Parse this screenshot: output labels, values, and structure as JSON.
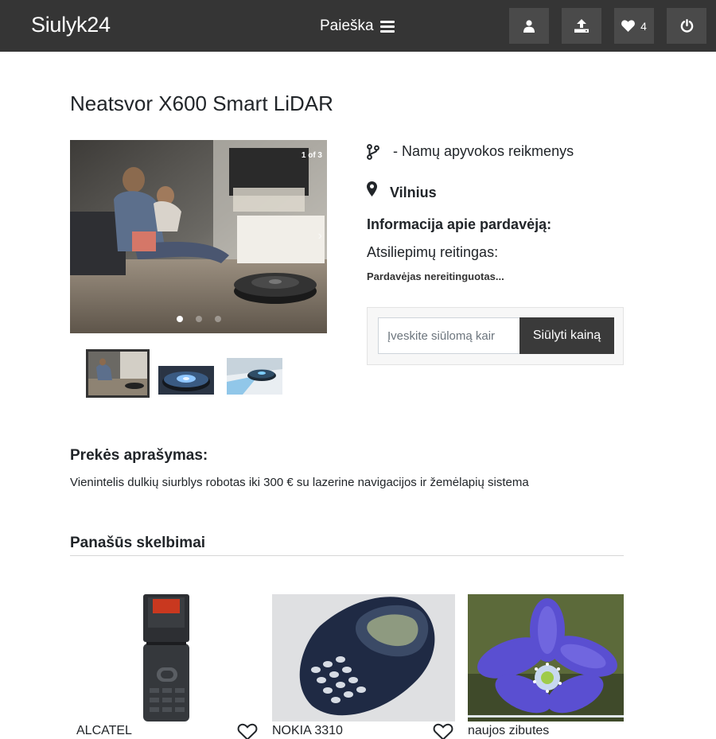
{
  "navbar": {
    "brand": "Siulyk24",
    "search_label": "Paieška",
    "favorites_count": "4",
    "icons": [
      "user-icon",
      "upload-icon",
      "heart-icon",
      "power-icon"
    ]
  },
  "listing": {
    "title": "Neatsvor X600 Smart LiDAR",
    "carousel_counter": "1 of 3",
    "category": "- Namų apyvokos reikmenys",
    "location": "Vilnius",
    "seller_heading": "Informacija apie pardavėją:",
    "rating_label": "Atsiliepimų reitingas:",
    "rating_value": "Pardavėjas nereitinguotas..."
  },
  "offer": {
    "placeholder": "Įveskite siūlomą kair",
    "button_label": "Siūlyti kainą"
  },
  "description": {
    "heading": "Prekės aprašymas:",
    "text": "Vienintelis dulkių siurblys robotas iki 300 € su lazerine navigacijos ir žemėlapių sistema"
  },
  "similar": {
    "heading": "Panašūs skelbimai",
    "items": [
      {
        "label": "ALCATEL"
      },
      {
        "label": "NOKIA 3310"
      },
      {
        "label": "naujos zibutes"
      }
    ]
  },
  "colors": {
    "navbar_bg": "#353535",
    "nav_button_bg": "#4a4a4a",
    "offer_button_bg": "#3a3a3a"
  }
}
